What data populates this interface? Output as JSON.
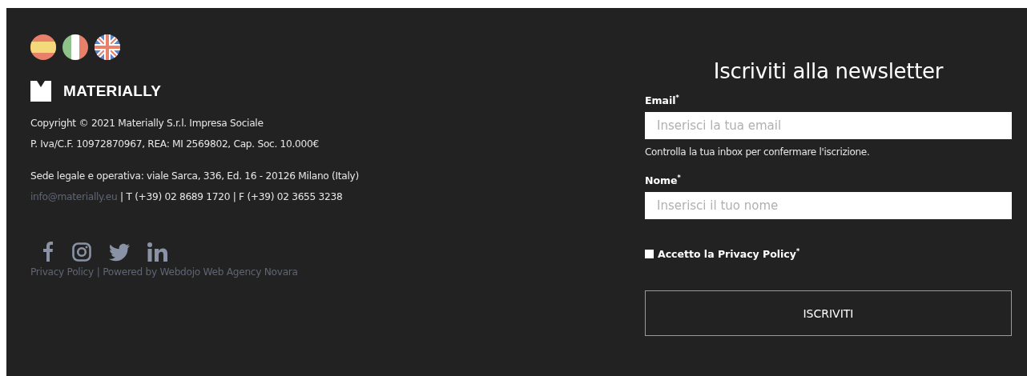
{
  "languages": [
    {
      "kind": "es"
    },
    {
      "kind": "it"
    },
    {
      "kind": "en"
    }
  ],
  "brand": {
    "name": "MATERIALLY"
  },
  "company": {
    "copyright": "Copyright © 2021 Materially S.r.l. Impresa Sociale",
    "tax_info": "P. Iva/C.F. 10972870967, REA: MI 2569802, Cap. Soc. 10.000€",
    "address": "Sede legale e operativa: viale Sarca, 336, Ed. 16 - 20126 Milano (Italy)",
    "email": "info@materially.eu",
    "phones": " | T (+39) 02 8689 1720 | F (+39) 02 3655 3238"
  },
  "social": [
    {
      "kind": "facebook"
    },
    {
      "kind": "instagram"
    },
    {
      "kind": "twitter"
    },
    {
      "kind": "linkedin"
    }
  ],
  "footer_links": {
    "privacy": "Privacy Policy",
    "powered_by": "| Powered by Webdojo Web Agency Novara"
  },
  "newsletter": {
    "title": "Iscriviti alla newsletter",
    "fields": [
      {
        "label": "Email$^{*}$",
        "placeholder": "Inserisci la tua email",
        "hint": "Controlla la tua inbox per confermare l'iscrizione."
      },
      {
        "label": "Nome$^{*}$",
        "placeholder": "Inserisci il tuo nome"
      }
    ],
    "consent": {
      "label": "Accetto la Privacy Policy$^{*}$",
      "checked": false
    },
    "button": "ISCRIVITI"
  }
}
